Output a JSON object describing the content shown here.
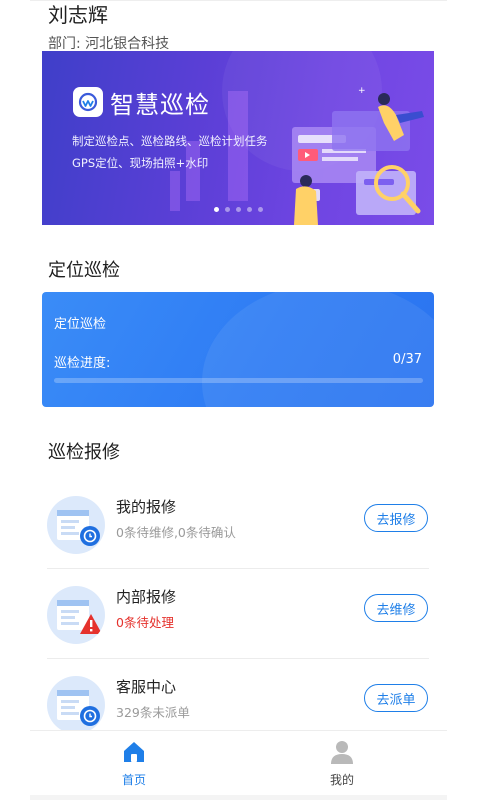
{
  "user": {
    "name": "刘志辉",
    "department": "部门:  河北银合科技"
  },
  "banner": {
    "title": "智慧巡检",
    "line1": "制定巡检点、巡检路线、巡检计划任务",
    "line2": "GPS定位、现场拍照+水印",
    "slide_count": 5,
    "active_slide": 0
  },
  "positioning": {
    "section_title": "定位巡检",
    "card_title": "定位巡检",
    "progress_label": "巡检进度:",
    "progress_text": "0/37",
    "progress_done": 0,
    "progress_total": 37
  },
  "repair": {
    "section_title": "巡检报修",
    "items": [
      {
        "name": "我的报修",
        "sub": "0条待维修,0条待确认",
        "button": "去报修",
        "icon": "clock-badge-icon"
      },
      {
        "name": "内部报修",
        "sub": "0条待处理",
        "button": "去维修",
        "icon": "warning-badge-icon"
      },
      {
        "name": "客服中心",
        "sub": "329条未派单",
        "button": "去派单",
        "icon": "clock-badge-icon"
      }
    ]
  },
  "nav": {
    "home": "首页",
    "mine": "我的"
  },
  "colors": {
    "accent": "#1f7fe8",
    "warning": "#e5322d",
    "card": "#2f7cf4"
  }
}
